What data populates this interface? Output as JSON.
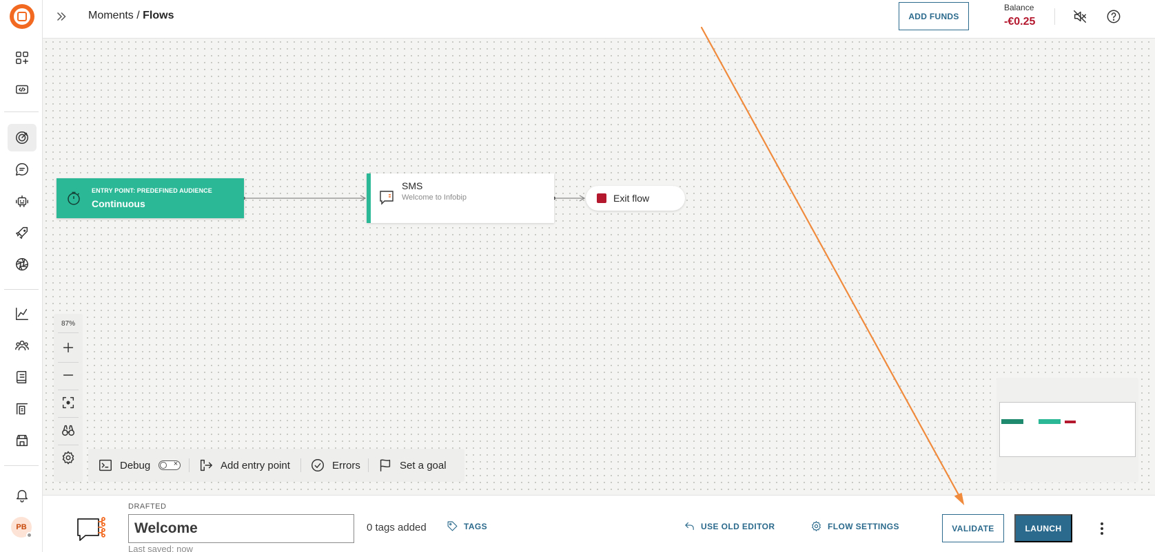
{
  "header": {
    "breadcrumb_parent": "Moments",
    "breadcrumb_separator": " / ",
    "breadcrumb_current": "Flows",
    "add_funds_label": "ADD FUNDS",
    "balance_label": "Balance",
    "balance_value": "-€0.25"
  },
  "canvas": {
    "entry_node": {
      "subtitle": "ENTRY POINT: PREDEFINED AUDIENCE",
      "title": "Continuous"
    },
    "sms_node": {
      "title": "SMS",
      "subtitle": "Welcome to Infobip"
    },
    "exit_node": {
      "label": "Exit flow"
    },
    "zoom_level": "87%"
  },
  "toolbar": {
    "debug_label": "Debug",
    "add_entry_label": "Add entry point",
    "errors_label": "Errors",
    "goal_label": "Set a goal"
  },
  "footer": {
    "status": "DRAFTED",
    "flow_name": "Welcome",
    "last_saved": "Last saved: now",
    "tags_count": "0 tags added",
    "tags_label": "TAGS",
    "old_editor_label": "USE OLD EDITOR",
    "flow_settings_label": "FLOW SETTINGS",
    "validate_label": "VALIDATE",
    "launch_label": "LAUNCH"
  },
  "user": {
    "initials": "PB"
  },
  "colors": {
    "accent": "#2b6a8c",
    "entry_green": "#2bb896",
    "exit_red": "#b4182f",
    "brand_orange": "#f26a21",
    "annotation_orange": "#f08a3c"
  },
  "icons": {
    "sidebar": [
      "apps-add-icon",
      "code-icon",
      "target-icon",
      "chat-icon",
      "bot-icon",
      "rocket-icon",
      "aperture-icon",
      "analytics-icon",
      "people-icon",
      "book-icon",
      "report-icon",
      "store-icon",
      "bell-icon"
    ]
  }
}
